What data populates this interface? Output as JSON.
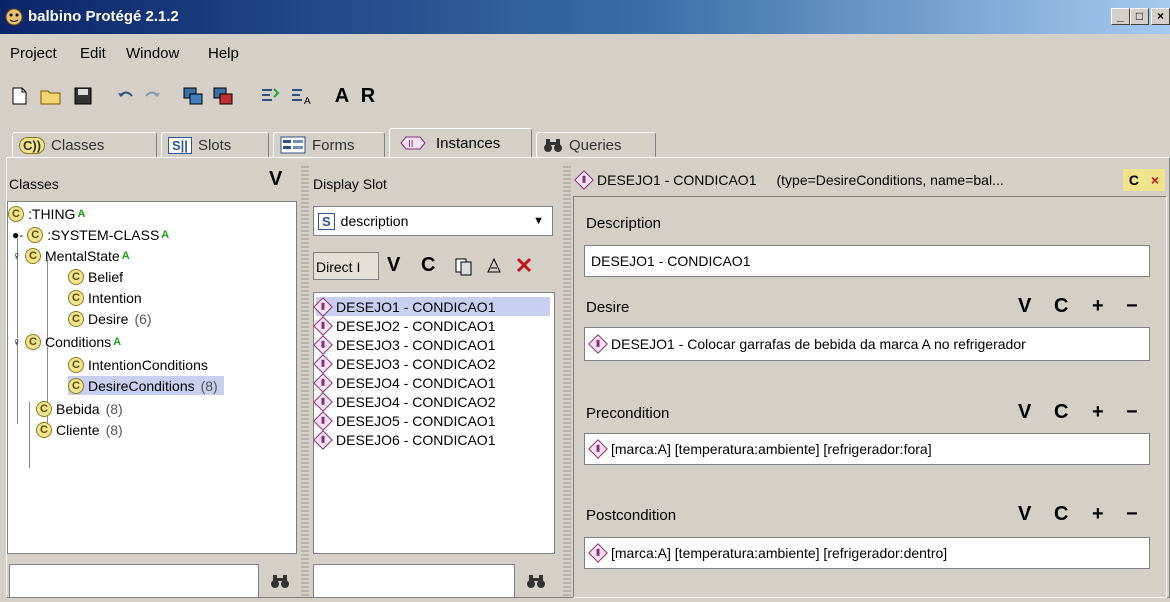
{
  "window": {
    "title": "balbino  Protégé 2.1.2",
    "controls": {
      "minimize": "_",
      "maximize": "□",
      "close": "×"
    }
  },
  "menu": [
    "Project",
    "Edit",
    "Window",
    "Help"
  ],
  "toolbar": {
    "a_label": "A",
    "r_label": "R"
  },
  "tabs": [
    {
      "label": "Classes",
      "icon": "C))"
    },
    {
      "label": "Slots",
      "icon": "S||"
    },
    {
      "label": "Forms",
      "icon": "form-icon"
    },
    {
      "label": "Instances",
      "icon": "instance-icon"
    },
    {
      "label": "Queries",
      "icon": "binoculars-icon"
    }
  ],
  "classes_panel": {
    "header": "Classes",
    "v_label": "V",
    "tree": [
      {
        "label": ":THING",
        "abstract": "A"
      },
      {
        "label": ":SYSTEM-CLASS",
        "abstract": "A"
      },
      {
        "label": "MentalState",
        "abstract": "A"
      },
      {
        "label": "Belief"
      },
      {
        "label": "Intention"
      },
      {
        "label": "Desire",
        "count": "(6)"
      },
      {
        "label": "Conditions",
        "abstract": "A"
      },
      {
        "label": "IntentionConditions"
      },
      {
        "label": "DesireConditions",
        "count": "(8)"
      },
      {
        "label": "Bebida",
        "count": "(8)"
      },
      {
        "label": "Cliente",
        "count": "(8)"
      }
    ]
  },
  "instances_panel": {
    "header": "Display Slot",
    "slot_icon": "S",
    "slot_value": "description",
    "direct_label": "Direct I",
    "v_label": "V",
    "c_label": "C",
    "items": [
      "DESEJO1 - CONDICAO1",
      "DESEJO2 - CONDICAO1",
      "DESEJO3 - CONDICAO1",
      "DESEJO3 - CONDICAO2",
      "DESEJO4 - CONDICAO1",
      "DESEJO4 - CONDICAO2",
      "DESEJO5 - CONDICAO1",
      "DESEJO6 - CONDICAO1"
    ]
  },
  "form_panel": {
    "header_title": "DESEJO1 - CONDICAO1",
    "header_meta": "(type=DesireConditions, name=bal...",
    "c_badge": "C",
    "close_x": "×",
    "description_label": "Description",
    "description_value": "DESEJO1 - CONDICAO1",
    "desire_label": "Desire",
    "desire_value": "DESEJO1 - Colocar garrafas de bebida da marca A no refrigerador",
    "precondition_label": "Precondition",
    "precondition_value": "[marca:A]  [temperatura:ambiente]  [refrigerador:fora]",
    "postcondition_label": "Postcondition",
    "postcondition_value": "[marca:A]  [temperatura:ambiente]  [refrigerador:dentro]",
    "controls": {
      "v": "V",
      "c": "C",
      "plus": "+",
      "minus": "−"
    }
  }
}
